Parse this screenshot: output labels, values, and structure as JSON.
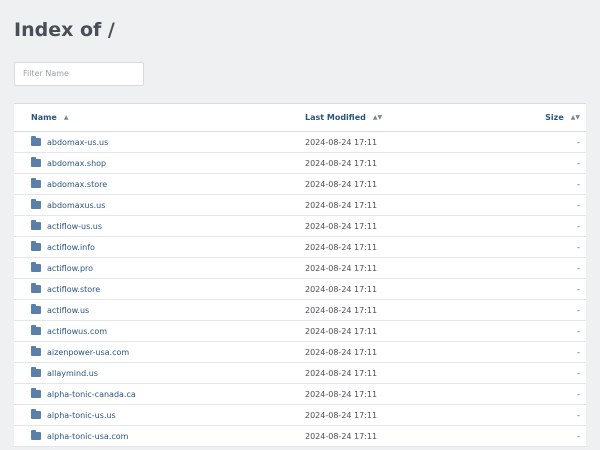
{
  "page": {
    "title": "Index of /"
  },
  "filter": {
    "placeholder": "Filter Name"
  },
  "table": {
    "columns": {
      "name": "Name",
      "modified": "Last Modified",
      "size": "Size"
    },
    "rows": [
      {
        "name": "abdomax-us.us",
        "modified": "2024-08-24 17:11",
        "size": "-"
      },
      {
        "name": "abdomax.shop",
        "modified": "2024-08-24 17:11",
        "size": "-"
      },
      {
        "name": "abdomax.store",
        "modified": "2024-08-24 17:11",
        "size": "-"
      },
      {
        "name": "abdomaxus.us",
        "modified": "2024-08-24 17:11",
        "size": "-"
      },
      {
        "name": "actiflow-us.us",
        "modified": "2024-08-24 17:11",
        "size": "-"
      },
      {
        "name": "actiflow.info",
        "modified": "2024-08-24 17:11",
        "size": "-"
      },
      {
        "name": "actiflow.pro",
        "modified": "2024-08-24 17:11",
        "size": "-"
      },
      {
        "name": "actiflow.store",
        "modified": "2024-08-24 17:11",
        "size": "-"
      },
      {
        "name": "actiflow.us",
        "modified": "2024-08-24 17:11",
        "size": "-"
      },
      {
        "name": "actiflowus.com",
        "modified": "2024-08-24 17:11",
        "size": "-"
      },
      {
        "name": "aizenpower-usa.com",
        "modified": "2024-08-24 17:11",
        "size": "-"
      },
      {
        "name": "allaymind.us",
        "modified": "2024-08-24 17:11",
        "size": "-"
      },
      {
        "name": "alpha-tonic-canada.ca",
        "modified": "2024-08-24 17:11",
        "size": "-"
      },
      {
        "name": "alpha-tonic-us.us",
        "modified": "2024-08-24 17:11",
        "size": "-"
      },
      {
        "name": "alpha-tonic-usa.com",
        "modified": "2024-08-24 17:11",
        "size": "-"
      }
    ]
  },
  "icons": {
    "row_icon": "folder-icon",
    "sort_icon": "sort-arrows-icon"
  }
}
